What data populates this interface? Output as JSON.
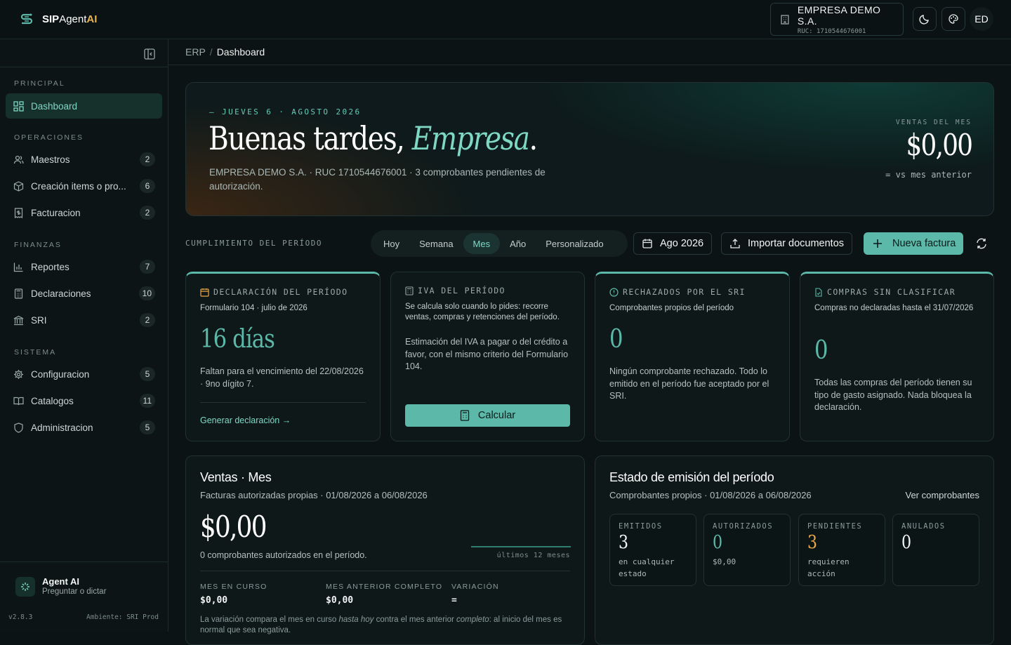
{
  "brand": {
    "sip": "SIP",
    "agent": "Agent",
    "ai": "AI"
  },
  "company": {
    "name": "EMPRESA DEMO S.A.",
    "ruc": "RUC: 1710544676001"
  },
  "user": {
    "initials": "ED"
  },
  "breadcrumb": {
    "root": "ERP",
    "current": "Dashboard"
  },
  "sidebar": {
    "sections": [
      {
        "title": "PRINCIPAL",
        "items": [
          {
            "label": "Dashboard",
            "icon": "dashboard-icon",
            "active": true
          }
        ]
      },
      {
        "title": "OPERACIONES",
        "items": [
          {
            "label": "Maestros",
            "icon": "users-icon",
            "badge": "2"
          },
          {
            "label": "Creación items o pro...",
            "icon": "box-icon",
            "badge": "6"
          },
          {
            "label": "Facturacion",
            "icon": "invoice-icon",
            "badge": "2"
          }
        ]
      },
      {
        "title": "FINANZAS",
        "items": [
          {
            "label": "Reportes",
            "icon": "bar-chart-icon",
            "badge": "7"
          },
          {
            "label": "Declaraciones",
            "icon": "calculator-icon",
            "badge": "10"
          },
          {
            "label": "SRI",
            "icon": "bank-icon",
            "badge": "2"
          }
        ]
      },
      {
        "title": "SISTEMA",
        "items": [
          {
            "label": "Configuracion",
            "icon": "gear-icon",
            "badge": "5"
          },
          {
            "label": "Catalogos",
            "icon": "book-icon",
            "badge": "11"
          },
          {
            "label": "Administracion",
            "icon": "shield-icon",
            "badge": "5"
          }
        ]
      }
    ],
    "agent": {
      "title": "Agent AI",
      "subtitle": "Preguntar o dictar"
    },
    "version": "v2.8.3",
    "environment": "Ambiente: SRI Prod"
  },
  "hero": {
    "date": "— JUEVES 6 · AGOSTO 2026",
    "greeting": "Buenas tardes, ",
    "name": "Empresa",
    "dot": ".",
    "description": "EMPRESA DEMO S.A. · RUC 1710544676001 · 3 comprobantes pendientes de autorización.",
    "sales_label": "VENTAS DEL MES",
    "sales_value": "$0,00",
    "sales_compare": "= vs mes anterior"
  },
  "toolbar": {
    "section_label": "CUMPLIMIENTO DEL PERÍODO",
    "periods": [
      "Hoy",
      "Semana",
      "Mes",
      "Año",
      "Personalizado"
    ],
    "active_period": "Mes",
    "month": "Ago 2026",
    "import": "Importar documentos",
    "new_invoice": "Nueva factura"
  },
  "cards": {
    "declaracion": {
      "title": "DECLARACIÓN DEL PERÍODO",
      "subtitle": "Formulario 104 · julio de 2026",
      "value": "16 días",
      "text": "Faltan para el vencimiento del 22/08/2026 · 9no dígito 7.",
      "link": "Generar declaración →"
    },
    "iva": {
      "title": "IVA DEL PERÍODO",
      "subtitle": "Se calcula solo cuando lo pides: recorre ventas, compras y retenciones del período.",
      "text": "Estimación del IVA a pagar o del crédito a favor, con el mismo criterio del Formulario 104.",
      "button": "Calcular"
    },
    "rechazados": {
      "title": "RECHAZADOS POR EL SRI",
      "subtitle": "Comprobantes propios del período",
      "value": "0",
      "text": "Ningún comprobante rechazado. Todo lo emitido en el período fue aceptado por el SRI."
    },
    "compras": {
      "title": "COMPRAS SIN CLASIFICAR",
      "subtitle": "Compras no declaradas hasta el 31/07/2026",
      "value": "0",
      "text": "Todas las compras del período tienen su tipo de gasto asignado. Nada bloquea la declaración."
    }
  },
  "sales": {
    "title": "Ventas · Mes",
    "subtitle": "Facturas autorizadas propias · 01/08/2026 a 06/08/2026",
    "value": "$0,00",
    "count": "0 comprobantes autorizados en el período.",
    "spark_label": "últimos 12 meses",
    "metrics": [
      {
        "label": "MES EN CURSO",
        "value": "$0,00"
      },
      {
        "label": "MES ANTERIOR COMPLETO",
        "value": "$0,00"
      },
      {
        "label": "VARIACIÓN",
        "value": "="
      }
    ],
    "note_a": "La variación compara el mes en curso ",
    "note_b": "hasta hoy",
    "note_c": " contra el mes anterior ",
    "note_d": "completo",
    "note_e": ": al inicio del mes es normal que sea negativa."
  },
  "emision": {
    "title": "Estado de emisión del período",
    "subtitle": "Comprobantes propios · 01/08/2026 a 06/08/2026",
    "link": "Ver comprobantes",
    "stats": [
      {
        "label": "EMITIDOS",
        "value": "3",
        "desc": "en cualquier estado",
        "color": "#f2f5f4"
      },
      {
        "label": "AUTORIZADOS",
        "value": "0",
        "desc": "$0,00",
        "color": "#5cb8a8"
      },
      {
        "label": "PENDIENTES",
        "value": "3",
        "desc": "requieren acción",
        "color": "#e9a84a"
      },
      {
        "label": "ANULADOS",
        "value": "0",
        "desc": "",
        "color": "#f2f5f4"
      }
    ]
  },
  "colors": {
    "accent": "#5cb8a8",
    "accent_light": "#7fd8c4",
    "warning": "#e9a84a",
    "bg": "#0b1314"
  }
}
